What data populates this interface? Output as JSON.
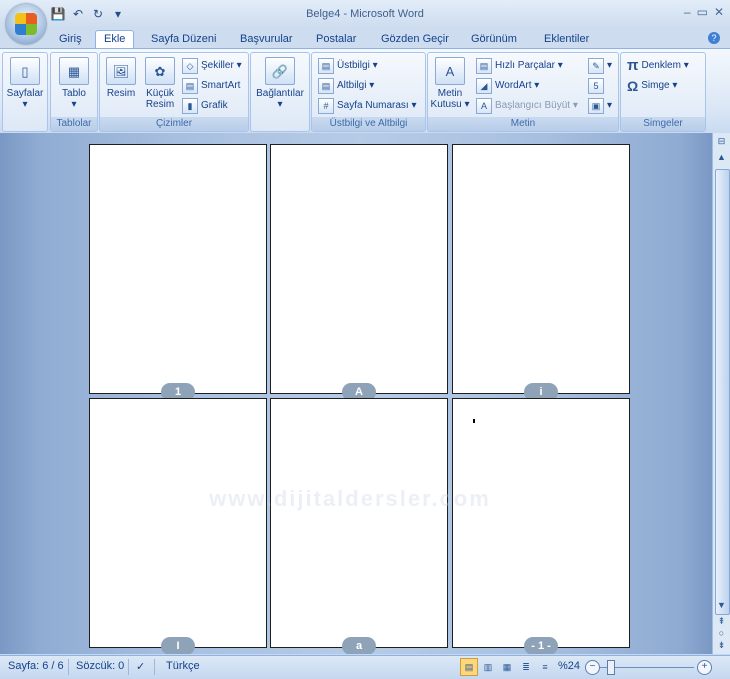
{
  "window": {
    "title": "Belge4 - Microsoft Word",
    "controls": [
      "–",
      "▭",
      "✕"
    ]
  },
  "qat": {
    "icons": [
      "save-icon",
      "undo-icon",
      "redo-icon",
      "customize-icon"
    ]
  },
  "tabs": [
    "Giriş",
    "Ekle",
    "Sayfa Düzeni",
    "Başvurular",
    "Postalar",
    "Gözden Geçir",
    "Görünüm",
    "Eklentiler"
  ],
  "active_tab": "Ekle",
  "ribbon": {
    "pages": {
      "label": "Sayfalar",
      "group": ""
    },
    "tables": {
      "table": "Tablo",
      "group": "Tablolar"
    },
    "illustrations": {
      "picture": "Resim",
      "clipart_line1": "Küçük",
      "clipart_line2": "Resim",
      "shapes": "Şekiller ▾",
      "smartart": "SmartArt",
      "chart": "Grafik",
      "group": "Çizimler"
    },
    "links": {
      "label": "Bağlantılar",
      "group": ""
    },
    "header_footer": {
      "header": "Üstbilgi ▾",
      "footer": "Altbilgi ▾",
      "page_number": "Sayfa Numarası ▾",
      "group": "Üstbilgi ve Altbilgi"
    },
    "text": {
      "textbox_line1": "Metin",
      "textbox_line2": "Kutusu ▾",
      "quick_parts": "Hızlı Parçalar ▾",
      "wordart": "WordArt ▾",
      "dropcap": "Başlangıcı Büyüt ▾",
      "group": "Metin"
    },
    "symbols": {
      "equation": "Denklem ▾",
      "symbol": "Simge ▾",
      "group": "Simgeler"
    }
  },
  "pages": [
    "1",
    "A",
    "i",
    "I",
    "a",
    "- 1 -"
  ],
  "watermark": "www.dijitaldersler.com",
  "status": {
    "page": "Sayfa: 6 / 6",
    "words": "Sözcük: 0",
    "language": "Türkçe",
    "zoom": "%24"
  }
}
